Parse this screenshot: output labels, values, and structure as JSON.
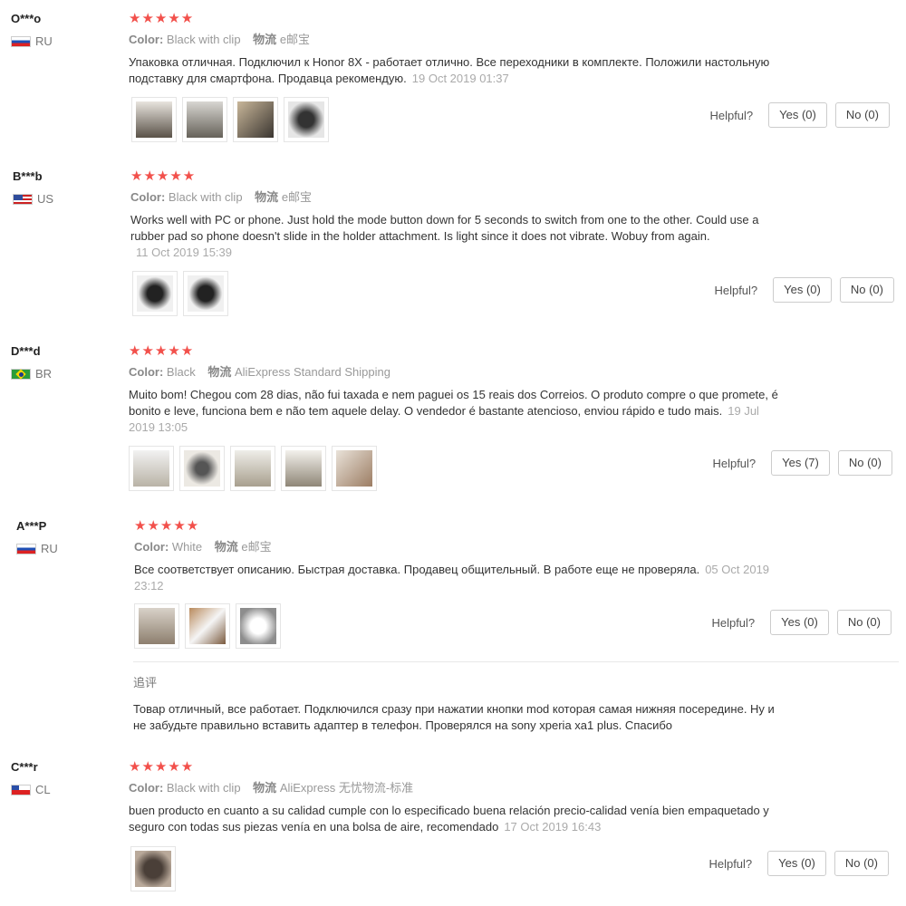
{
  "labels": {
    "color": "Color:",
    "shipping": "物流",
    "helpful": "Helpful?",
    "followup": "追评"
  },
  "colors": {
    "star": "#f2504b",
    "date": "#aaaaaa",
    "border": "#cccccc"
  },
  "reviews": [
    {
      "user": "O***o",
      "country": "RU",
      "stars": "★★★★★",
      "rating": 5,
      "color": "Black with clip",
      "shipping": "e邮宝",
      "text": "Упаковка отличная. Подключил к Honor 8X - работает отлично. Все переходники в комплекте. Положили настольную подставку для смартфона. Продавца рекомендую.",
      "date": "19 Oct 2019 01:37",
      "yes": "Yes (0)",
      "no": "No (0)",
      "photos": 4
    },
    {
      "user": "B***b",
      "country": "US",
      "stars": "★★★★★",
      "rating": 5,
      "color": "Black with clip",
      "shipping": "e邮宝",
      "text": "Works well with PC or phone. Just hold the mode button down for 5 seconds to switch from one to the other. Could use a rubber pad so phone doesn't slide in the holder attachment. Is light since it does not vibrate. Wobuy from again.",
      "date": "11 Oct 2019 15:39",
      "yes": "Yes (0)",
      "no": "No (0)",
      "photos": 2
    },
    {
      "user": "D***d",
      "country": "BR",
      "stars": "★★★★★",
      "rating": 5,
      "color": "Black",
      "shipping": "AliExpress Standard Shipping",
      "text": "Muito bom! Chegou com 28 dias, não fui taxada e nem paguei os 15 reais dos Correios. O produto compre o que promete, é bonito e leve, funciona bem e não tem aquele delay. O vendedor é bastante atencioso, enviou rápido e tudo mais.",
      "date": "19 Jul 2019 13:05",
      "yes": "Yes (7)",
      "no": "No (0)",
      "photos": 5
    },
    {
      "user": "A***P",
      "country": "RU",
      "stars": "★★★★★",
      "rating": 5,
      "color": "White",
      "shipping": "e邮宝",
      "text": "Все соответствует описанию. Быстрая доставка. Продавец общительный. В работе еще не проверяла.",
      "date": "05 Oct 2019 23:12",
      "yes": "Yes (0)",
      "no": "No (0)",
      "photos": 3,
      "followup_text": "Товар отличный, все работает. Подключился сразу при нажатии кнопки mod которая самая нижняя посередине. Ну и не забудьте правильно вставить адаптер в телефон. Проверялся на sony xperia xa1 plus. Спасибо"
    },
    {
      "user": "C***r",
      "country": "CL",
      "stars": "★★★★★",
      "rating": 5,
      "color": "Black with clip",
      "shipping": "AliExpress 无忧物流-标准",
      "text": "buen producto en cuanto a su calidad cumple con lo especificado buena relación precio-calidad venía bien empaquetado y seguro con todas sus piezas venía en una bolsa de aire, recomendado",
      "date": "17 Oct 2019 16:43",
      "yes": "Yes (0)",
      "no": "No (0)",
      "photos": 1
    }
  ]
}
